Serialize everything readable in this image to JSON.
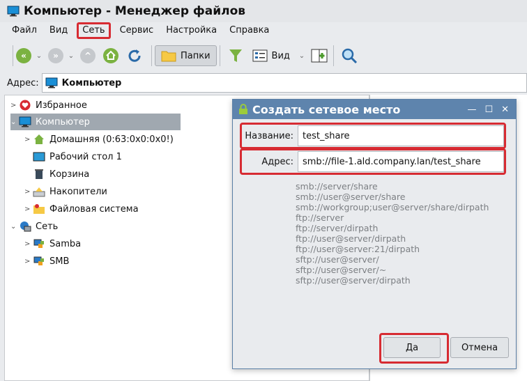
{
  "window": {
    "title": "Компьютер - Менеджер файлов"
  },
  "menu": [
    "Файл",
    "Вид",
    "Сеть",
    "Сервис",
    "Настройка",
    "Справка"
  ],
  "toolbar": {
    "folders_label": "Папки",
    "view_label": "Вид"
  },
  "address": {
    "label": "Адрес:",
    "value": "Компьютер"
  },
  "tree": {
    "items": [
      {
        "label": "Избранное",
        "icon": "heart-icon"
      },
      {
        "label": "Компьютер",
        "icon": "monitor-icon"
      },
      {
        "label": "Домашняя (0:63:0x0:0x0!)",
        "icon": "home-icon"
      },
      {
        "label": "Рабочий стол 1",
        "icon": "desktop-icon"
      },
      {
        "label": "Корзина",
        "icon": "trash-icon"
      },
      {
        "label": "Накопители",
        "icon": "drives-icon"
      },
      {
        "label": "Файловая система",
        "icon": "filesystem-icon"
      },
      {
        "label": "Сеть",
        "icon": "network-icon"
      },
      {
        "label": "Samba",
        "icon": "samba-icon"
      },
      {
        "label": "SMB",
        "icon": "smb-icon"
      }
    ]
  },
  "dialog": {
    "title": "Создать сетевое место",
    "name_label": "Название:",
    "name_value": "test_share",
    "address_label": "Адрес:",
    "address_value": "smb://file-1.ald.company.lan/test_share",
    "examples": [
      "smb://server/share",
      "smb://user@server/share",
      "smb://workgroup;user@server/share/dirpath",
      "ftp://server",
      "ftp://server/dirpath",
      "ftp://user@server/dirpath",
      "ftp://user@server:21/dirpath",
      "sftp://user@server/",
      "sftp://user@server/~",
      "sftp://user@server/dirpath"
    ],
    "ok_label": "Да",
    "cancel_label": "Отмена"
  },
  "colors": {
    "dialog_title_bg": "#5e84ad",
    "highlight": "#d72b32",
    "selection": "#a0a8b0"
  }
}
